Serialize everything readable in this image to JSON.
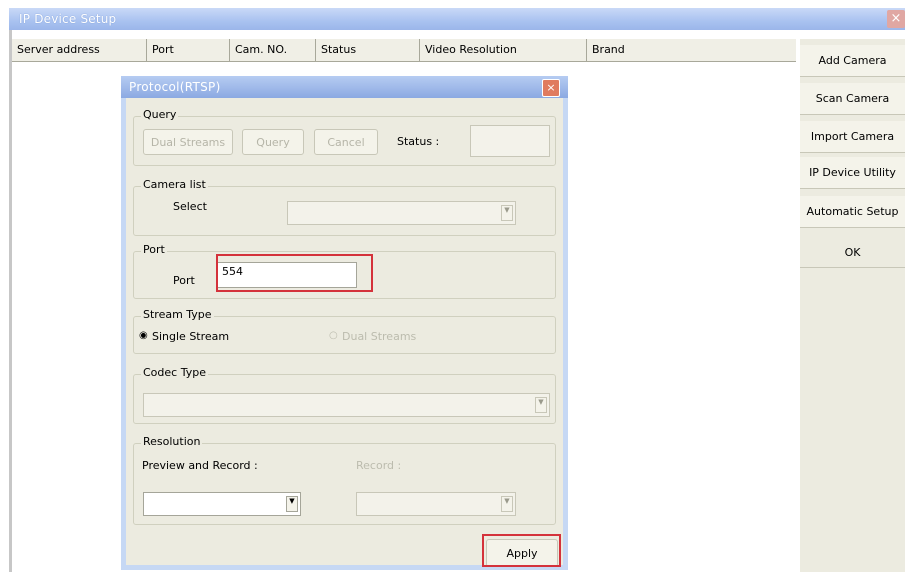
{
  "window": {
    "title": "IP Device Setup",
    "close": "×"
  },
  "table": {
    "columns": [
      "Server address",
      "Port",
      "Cam. NO.",
      "Status",
      "Video Resolution",
      "Brand"
    ]
  },
  "side_buttons": [
    "Add Camera",
    "Scan Camera",
    "Import Camera",
    "IP Device Utility",
    "Automatic Setup",
    "OK"
  ],
  "dialog": {
    "title": "Protocol(RTSP)",
    "close": "×",
    "query": {
      "legend": "Query",
      "dual_streams": "Dual Streams",
      "query": "Query",
      "cancel": "Cancel",
      "status_label": "Status :",
      "status_value": ""
    },
    "camera_list": {
      "legend": "Camera list",
      "select_label": "Select",
      "select_value": ""
    },
    "port": {
      "legend": "Port",
      "label": "Port",
      "value": "554"
    },
    "stream_type": {
      "legend": "Stream Type",
      "single": "Single Stream",
      "dual": "Dual Streams",
      "selected": "Single Stream"
    },
    "codec_type": {
      "legend": "Codec Type",
      "value": ""
    },
    "resolution": {
      "legend": "Resolution",
      "preview_label": "Preview and Record :",
      "preview_value": "",
      "record_label": "Record :",
      "record_value": ""
    },
    "apply": "Apply"
  },
  "colors": {
    "highlight": "#d4323b",
    "titlebar": "#9bb6ea",
    "dialog_frame": "#c6d8f4"
  }
}
